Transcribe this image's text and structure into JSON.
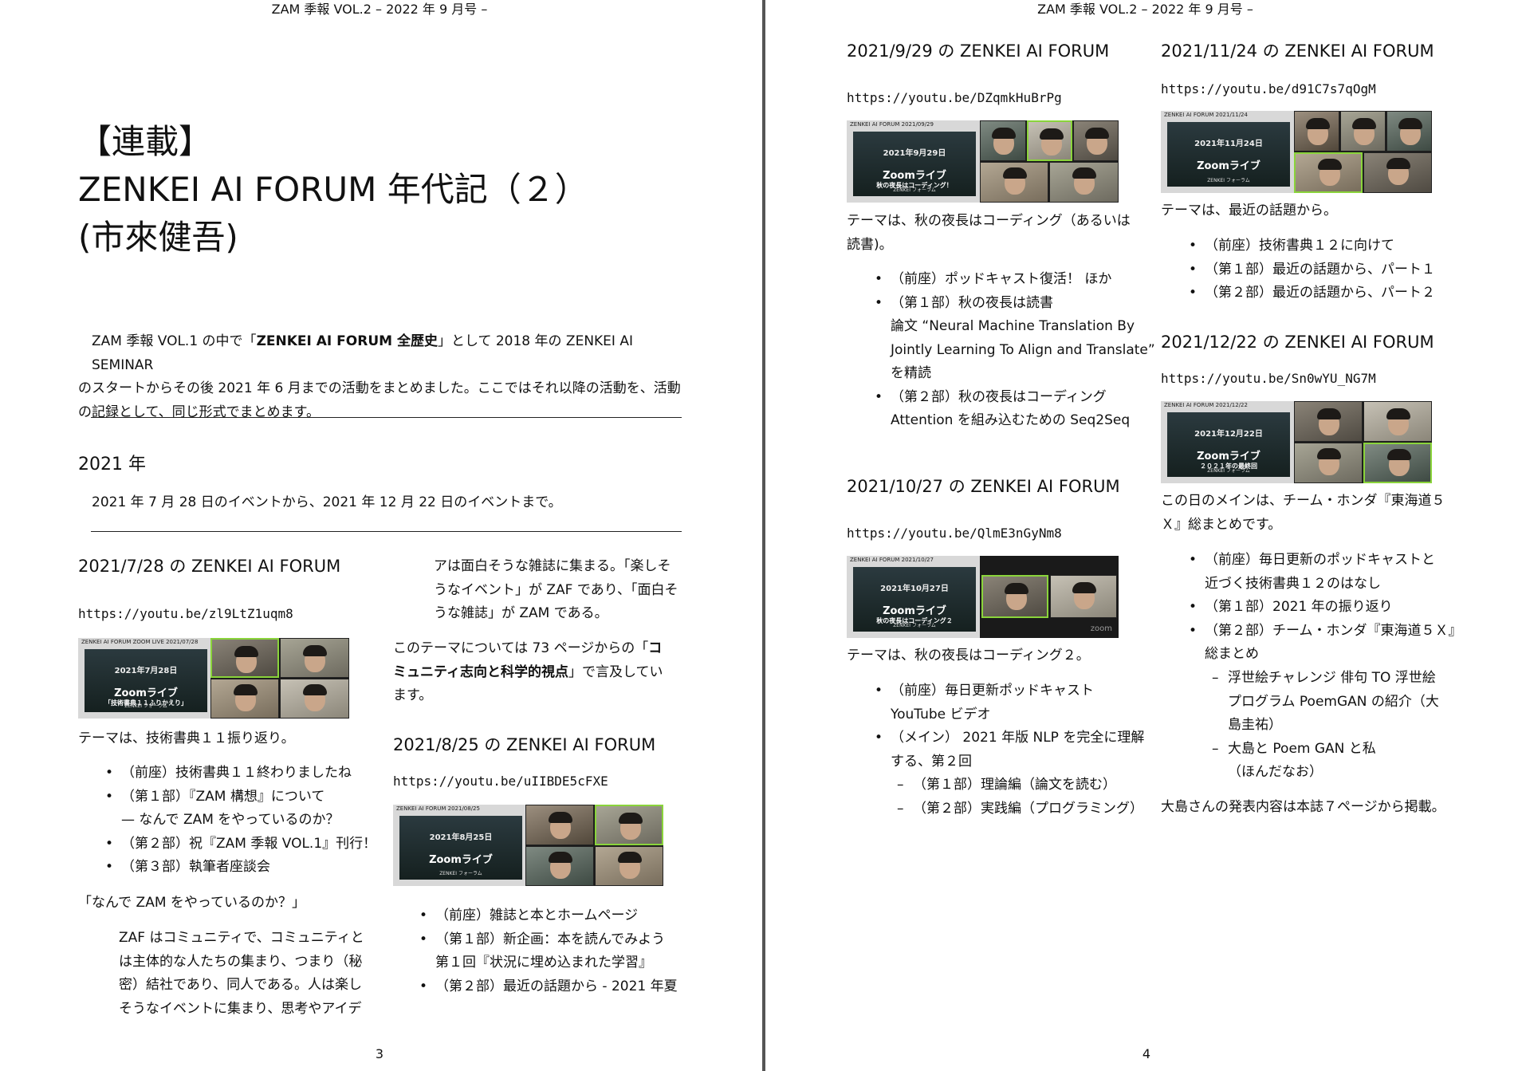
{
  "header_text": "ZAM 季報 VOL.2 – 2022 年 9 月号 –",
  "left": {
    "page_number": "3",
    "title_line1": "【連載】",
    "title_line2": "ZENKEI AI FORUM 年代記（２）",
    "title_line3": "(市來健吾)",
    "intro_a": "ZAM 季報 VOL.1 の中で「",
    "intro_bold": "ZENKEI AI FORUM 全歴史",
    "intro_b": "」として 2018 年の ZENKEI AI SEMINAR",
    "intro_line2": "のスタートからその後 2021 年 6 月までの活動をまとめました。ここではそれ以降の活動を、活動",
    "intro_line3": "の記録として、同じ形式でまとめます。",
    "year_heading": "2021 年",
    "year_desc": "2021 年 7 月 28 日のイベントから、2021 年 12 月 22 日のイベントまで。",
    "ev1": {
      "heading": "2021/7/28 の ZENKEI AI FORUM",
      "url": "https://youtu.be/zl9LtZ1uqm8",
      "thumb_top": "ZENKEI AI FORUM ZOOM LIVE 2021/07/28",
      "thumb_date": "2021年7月28日",
      "thumb_title": "Zoomライブ",
      "thumb_sub": "「技術書典１１ふりかえり」",
      "thumb_brand": "ZENKEI フォーラム",
      "theme": "テーマは、技術書典１１振り返り。",
      "items": [
        "（前座）技術書典１１終わりましたね",
        "（第１部）『ZAM 構想』について",
        "— なんで ZAM をやっているのか？",
        "（第２部）祝『ZAM 季報 VOL.1』刊行！",
        "（第３部）執筆者座談会"
      ],
      "quote_heading": "「なんで ZAM をやっているのか？」",
      "quote_lines": [
        "ZAF はコミュニティで、コミュニティと",
        "は主体的な人たちの集まり、つまり（秘",
        "密）結社であり、同人である。人は楽し",
        "そうなイベントに集まり、思考やアイデ"
      ]
    },
    "col2": {
      "cont_lines": [
        "アは面白そうな雑誌に集まる。「楽しそ",
        "うなイベント」が ZAF であり、「面白そ",
        "うな雑誌」が ZAM である。"
      ],
      "ref_a": "このテーマについては 73 ページからの「",
      "ref_bold1": "コ",
      "ref_bold2": "ミュニティ志向と科学的視点",
      "ref_b": "」で言及してい",
      "ref_c": "ます。"
    },
    "ev2": {
      "heading": "2021/8/25 の ZENKEI AI FORUM",
      "url": "https://youtu.be/uIIBDE5cFXE",
      "thumb_top": "ZENKEI AI FORUM 2021/08/25",
      "thumb_date": "2021年8月25日",
      "thumb_title": "Zoomライブ",
      "thumb_brand": "ZENKEI フォーラム",
      "items": [
        "（前座）雑誌と本とホームページ",
        "（第１部）新企画：本を読んでみよう",
        "第１回『状況に埋め込まれた学習』",
        "（第２部）最近の話題から - 2021 年夏"
      ]
    }
  },
  "right": {
    "page_number": "4",
    "ev3": {
      "heading": "2021/9/29 の ZENKEI AI FORUM",
      "url": "https://youtu.be/DZqmkHuBrPg",
      "thumb_top": "ZENKEI AI FORUM 2021/09/29",
      "thumb_date": "2021年9月29日",
      "thumb_title": "Zoomライブ",
      "thumb_sub": "秋の夜長はコーディング！",
      "thumb_brand": "ZENKEI フォーラム",
      "theme_line1": "テーマは、秋の夜長はコーディング（あるいは",
      "theme_line2": "読書)。",
      "items": [
        "（前座）ポッドキャスト復活！ ほか",
        "（第１部）秋の夜長は読書",
        "論文 “Neural Machine Translation By",
        "Jointly Learning To Align and Translate”",
        "を精読",
        "（第２部）秋の夜長はコーディング",
        "Attention を組み込むための Seq2Seq"
      ]
    },
    "ev4": {
      "heading": "2021/10/27 の ZENKEI AI FORUM",
      "url": "https://youtu.be/QlmE3nGyNm8",
      "thumb_top": "ZENKEI AI FORUM 2021/10/27",
      "thumb_date": "2021年10月27日",
      "thumb_title": "Zoomライブ",
      "thumb_sub": "秋の夜長はコーディング２",
      "thumb_brand": "ZENKEI フォーラム",
      "zoom_label": "zoom",
      "theme": "テーマは、秋の夜長はコーディング２。",
      "items": [
        "（前座）毎日更新ポッドキャスト",
        "YouTube ビデオ",
        "（メイン） 2021 年版 NLP を完全に理解",
        "する、第２回"
      ],
      "subitems": [
        "（第１部）理論編（論文を読む）",
        "（第２部）実践編（プログラミング）"
      ]
    },
    "ev5": {
      "heading": "2021/11/24 の ZENKEI AI FORUM",
      "url": "https://youtu.be/d91C7s7qOgM",
      "thumb_top": "ZENKEI AI FORUM 2021/11/24",
      "thumb_date": "2021年11月24日",
      "thumb_title": "Zoomライブ",
      "thumb_brand": "ZENKEI フォーラム",
      "theme": "テーマは、最近の話題から。",
      "items": [
        "（前座）技術書典１２に向けて",
        "（第１部）最近の話題から、パート１",
        "（第２部）最近の話題から、パート２"
      ]
    },
    "ev6": {
      "heading": "2021/12/22 の ZENKEI AI FORUM",
      "url": "https://youtu.be/Sn0wYU_NG7M",
      "thumb_top": "ZENKEI AI FORUM 2021/12/22",
      "thumb_date": "2021年12月22日",
      "thumb_title": "Zoomライブ",
      "thumb_sub": "２０２１年の最終回",
      "thumb_brand": "ZENKEI フォーラム",
      "theme_line1": "この日のメインは、チーム・ホンダ『東海道５",
      "theme_line2": "Ｘ』総まとめです。",
      "items": [
        "（前座）毎日更新のポッドキャストと",
        "近づく技術書典１２のはなし",
        "（第１部）2021 年の振り返り",
        "（第２部）チーム・ホンダ『東海道５Ｘ』",
        "総まとめ"
      ],
      "subitems": [
        "浮世絵チャレンジ 俳句 TO 浮世絵",
        "プログラム PoemGAN の紹介（大",
        "島圭祐）",
        "大島と Poem GAN と私",
        "（ほんだなお）"
      ],
      "closing": "大島さんの発表内容は本誌７ページから掲載。"
    }
  }
}
